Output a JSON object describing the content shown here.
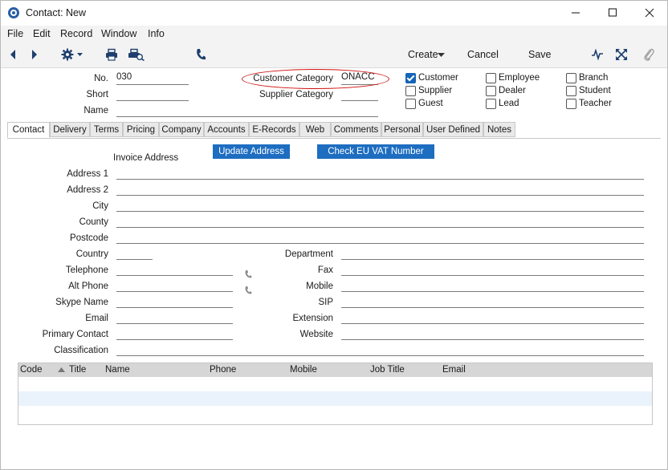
{
  "window": {
    "title": "Contact: New"
  },
  "menu": [
    "File",
    "Edit",
    "Record",
    "Window",
    "Info"
  ],
  "toolbar": {
    "create_label": "Create",
    "cancel_label": "Cancel",
    "save_label": "Save"
  },
  "header": {
    "no_label": "No.",
    "no_value": "030",
    "short_label": "Short",
    "short_value": "",
    "name_label": "Name",
    "name_value": "",
    "customer_category_label": "Customer Category",
    "customer_category_value": "ONACC",
    "supplier_category_label": "Supplier Category",
    "supplier_category_value": ""
  },
  "checkboxes": [
    {
      "label": "Customer",
      "checked": true
    },
    {
      "label": "Supplier",
      "checked": false
    },
    {
      "label": "Guest",
      "checked": false
    },
    {
      "label": "Employee",
      "checked": false
    },
    {
      "label": "Dealer",
      "checked": false
    },
    {
      "label": "Lead",
      "checked": false
    },
    {
      "label": "Branch",
      "checked": false
    },
    {
      "label": "Student",
      "checked": false
    },
    {
      "label": "Teacher",
      "checked": false
    }
  ],
  "tabs": [
    "Contact",
    "Delivery",
    "Terms",
    "Pricing",
    "Company",
    "Accounts",
    "E-Records",
    "Web",
    "Comments",
    "Personal",
    "User Defined",
    "Notes"
  ],
  "active_tab": "Contact",
  "contact": {
    "invoice_address_label": "Invoice Address",
    "update_address_button": "Update Address",
    "check_vat_button": "Check EU VAT Number",
    "address1_label": "Address 1",
    "address2_label": "Address 2",
    "city_label": "City",
    "county_label": "County",
    "postcode_label": "Postcode",
    "country_label": "Country",
    "telephone_label": "Telephone",
    "altphone_label": "Alt Phone",
    "skype_label": "Skype Name",
    "email_label": "Email",
    "primary_contact_label": "Primary Contact",
    "classification_label": "Classification",
    "department_label": "Department",
    "fax_label": "Fax",
    "mobile_label": "Mobile",
    "sip_label": "SIP",
    "extension_label": "Extension",
    "website_label": "Website"
  },
  "grid": {
    "columns": [
      "Code",
      "Title",
      "Name",
      "Phone",
      "Mobile",
      "Job Title",
      "Email"
    ],
    "rows": []
  },
  "colors": {
    "accent": "#1d6dc1",
    "highlight_ring": "#d01010"
  },
  "icons": [
    "app-icon",
    "minimize-icon",
    "maximize-icon",
    "close-icon",
    "back-arrow-icon",
    "forward-arrow-icon",
    "gear-icon",
    "print-icon",
    "print-preview-icon",
    "phone-icon",
    "activity-icon",
    "expand-icon",
    "paperclip-icon"
  ]
}
